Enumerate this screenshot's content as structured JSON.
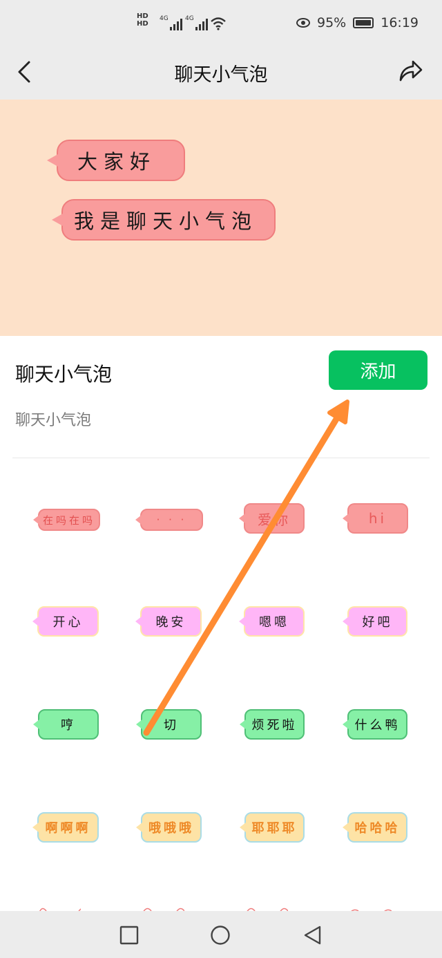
{
  "status_bar": {
    "hd1": "HD",
    "hd2": "HD",
    "net1": "4G",
    "net2": "4G",
    "battery": "95%",
    "time": "16:19"
  },
  "app_bar": {
    "title": "聊天小气泡",
    "back_icon": "chevron-left-icon",
    "share_icon": "share-icon"
  },
  "preview": {
    "bubble1": "大家好",
    "bubble2": "我是聊天小气泡"
  },
  "info": {
    "title": "聊天小气泡",
    "subtitle": "聊天小气泡",
    "add_button": "添加"
  },
  "colors": {
    "accent": "#07c160",
    "preview_bg": "#fde1c9",
    "arrow": "#ff8c33"
  },
  "stickers": [
    [
      {
        "text": "在吗在吗",
        "style": "red"
      },
      {
        "text": "· · ·",
        "style": "red"
      },
      {
        "text": "爱你",
        "style": "red-lg"
      },
      {
        "text": "hi",
        "style": "red-lg"
      }
    ],
    [
      {
        "text": "开心",
        "style": "pink"
      },
      {
        "text": "晚安",
        "style": "pink"
      },
      {
        "text": "嗯嗯",
        "style": "pink"
      },
      {
        "text": "好吧",
        "style": "pink"
      }
    ],
    [
      {
        "text": "哼",
        "style": "green"
      },
      {
        "text": "切",
        "style": "green"
      },
      {
        "text": "烦死啦",
        "style": "green"
      },
      {
        "text": "什么鸭",
        "style": "green"
      }
    ],
    [
      {
        "text": "啊啊啊",
        "style": "yellow"
      },
      {
        "text": "哦哦哦",
        "style": "yellow"
      },
      {
        "text": "耶耶耶",
        "style": "yellow"
      },
      {
        "text": "哈哈哈",
        "style": "yellow"
      }
    ]
  ],
  "nav_bar": {
    "recent_icon": "square-icon",
    "home_icon": "circle-icon",
    "back_icon": "triangle-back-icon"
  }
}
